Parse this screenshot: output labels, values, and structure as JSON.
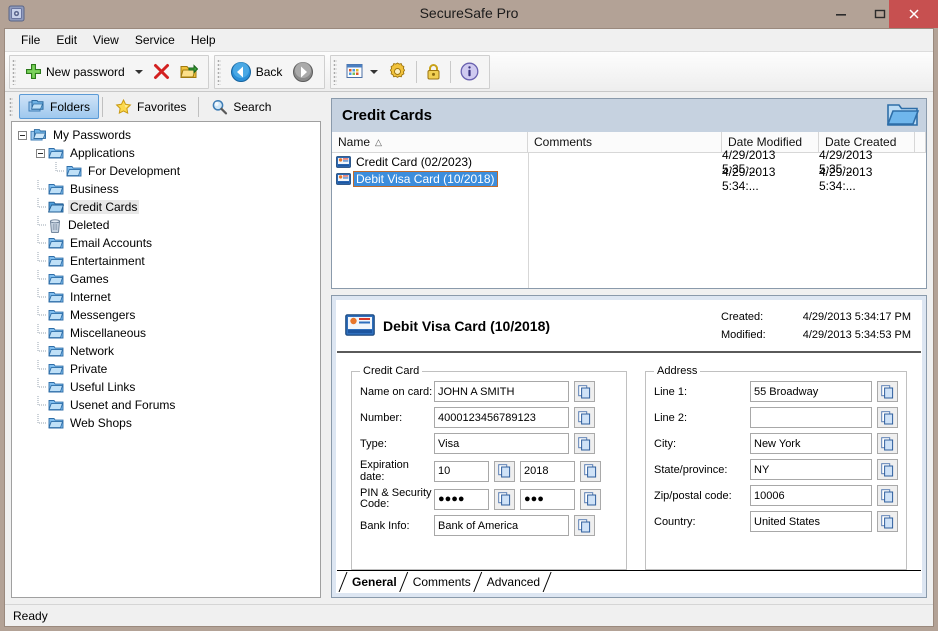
{
  "window": {
    "title": "SecureSafe Pro",
    "app_icon": "safe-icon",
    "minimize_label": "–",
    "maximize_label": "▭",
    "close_label": "✕",
    "titlebar_color": "#b3a296",
    "close_button_color": "#c75050"
  },
  "menubar": {
    "items": [
      {
        "label": "File"
      },
      {
        "label": "Edit"
      },
      {
        "label": "View"
      },
      {
        "label": "Service"
      },
      {
        "label": "Help"
      }
    ]
  },
  "toolbar": {
    "new_password_label": "New password",
    "back_label": "Back",
    "buttons": [
      {
        "name": "new-password",
        "label": "New password",
        "icon": "green-plus-icon"
      },
      {
        "name": "delete",
        "label": "",
        "icon": "red-x-icon"
      },
      {
        "name": "export",
        "label": "",
        "icon": "folder-export-icon"
      },
      {
        "name": "back",
        "label": "Back",
        "icon": "back-arrow-icon"
      },
      {
        "name": "forward",
        "label": "",
        "icon": "forward-arrow-icon"
      },
      {
        "name": "view-mode",
        "label": "",
        "icon": "window-list-icon"
      },
      {
        "name": "options",
        "label": "",
        "icon": "gear-icon"
      },
      {
        "name": "lock",
        "label": "",
        "icon": "padlock-icon"
      },
      {
        "name": "about",
        "label": "",
        "icon": "info-icon"
      }
    ]
  },
  "left_pane": {
    "tabs": [
      {
        "label": "Folders",
        "icon": "folders-icon",
        "active": true
      },
      {
        "label": "Favorites",
        "icon": "star-icon",
        "active": false
      },
      {
        "label": "Search",
        "icon": "magnifier-icon",
        "active": false
      }
    ],
    "tree": [
      {
        "label": "My Passwords",
        "depth": 0,
        "icon": "passwords-root-icon",
        "expander": "minus",
        "selected": false
      },
      {
        "label": "Applications",
        "depth": 1,
        "icon": "folder-icon",
        "expander": "minus",
        "selected": false
      },
      {
        "label": "For Development",
        "depth": 2,
        "icon": "folder-icon",
        "expander": "none",
        "selected": false
      },
      {
        "label": "Business",
        "depth": 1,
        "icon": "folder-icon",
        "expander": "none",
        "selected": false
      },
      {
        "label": "Credit Cards",
        "depth": 1,
        "icon": "folder-open-icon",
        "expander": "none",
        "selected": true
      },
      {
        "label": "Deleted",
        "depth": 1,
        "icon": "trash-icon",
        "expander": "none",
        "selected": false
      },
      {
        "label": "Email Accounts",
        "depth": 1,
        "icon": "folder-icon",
        "expander": "none",
        "selected": false
      },
      {
        "label": "Entertainment",
        "depth": 1,
        "icon": "folder-icon",
        "expander": "none",
        "selected": false
      },
      {
        "label": "Games",
        "depth": 1,
        "icon": "folder-icon",
        "expander": "none",
        "selected": false
      },
      {
        "label": "Internet",
        "depth": 1,
        "icon": "folder-icon",
        "expander": "none",
        "selected": false
      },
      {
        "label": "Messengers",
        "depth": 1,
        "icon": "folder-icon",
        "expander": "none",
        "selected": false
      },
      {
        "label": "Miscellaneous",
        "depth": 1,
        "icon": "folder-icon",
        "expander": "none",
        "selected": false
      },
      {
        "label": "Network",
        "depth": 1,
        "icon": "folder-icon",
        "expander": "none",
        "selected": false
      },
      {
        "label": "Private",
        "depth": 1,
        "icon": "folder-icon",
        "expander": "none",
        "selected": false
      },
      {
        "label": "Useful Links",
        "depth": 1,
        "icon": "folder-icon",
        "expander": "none",
        "selected": false
      },
      {
        "label": "Usenet and Forums",
        "depth": 1,
        "icon": "folder-icon",
        "expander": "none",
        "selected": false
      },
      {
        "label": "Web Shops",
        "depth": 1,
        "icon": "folder-icon",
        "expander": "none",
        "selected": false
      }
    ]
  },
  "list_panel": {
    "title": "Credit Cards",
    "header_icon": "open-folder-icon",
    "columns": [
      {
        "label": "Name",
        "sort": "△"
      },
      {
        "label": "Comments",
        "sort": ""
      },
      {
        "label": "Date Modified",
        "sort": ""
      },
      {
        "label": "Date Created",
        "sort": ""
      }
    ],
    "rows": [
      {
        "name": "Credit Card (02/2023)",
        "comments": "",
        "date_modified": "4/29/2013 5:35:...",
        "date_created": "4/29/2013 5:35:...",
        "icon": "credit-card-icon",
        "selected": false
      },
      {
        "name": "Debit Visa Card (10/2018)",
        "comments": "",
        "date_modified": "4/29/2013 5:34:...",
        "date_created": "4/29/2013 5:34:...",
        "icon": "credit-card-icon",
        "selected": true
      }
    ]
  },
  "detail": {
    "title": "Debit Visa Card (10/2018)",
    "icon": "credit-card-icon",
    "created_label": "Created:",
    "created_value": "4/29/2013 5:34:17 PM",
    "modified_label": "Modified:",
    "modified_value": "4/29/2013 5:34:53 PM",
    "credit_card_group": {
      "legend": "Credit Card",
      "fields": {
        "name_on_card_label": "Name on card:",
        "name_on_card_value": "JOHN A SMITH",
        "number_label": "Number:",
        "number_value": "4000123456789123",
        "type_label": "Type:",
        "type_value": "Visa",
        "expiration_label": "Expiration date:",
        "expiration_month": "10",
        "expiration_year": "2018",
        "pin_label": "PIN & Security Code:",
        "pin_value": "●●●●",
        "security_code_value": "●●●",
        "bank_info_label": "Bank Info:",
        "bank_info_value": "Bank of America"
      }
    },
    "address_group": {
      "legend": "Address",
      "fields": {
        "line1_label": "Line 1:",
        "line1_value": "55 Broadway",
        "line2_label": "Line 2:",
        "line2_value": "",
        "city_label": "City:",
        "city_value": "New York",
        "state_label": "State/province:",
        "state_value": "NY",
        "zip_label": "Zip/postal code:",
        "zip_value": "10006",
        "country_label": "Country:",
        "country_value": "United States"
      }
    },
    "tabs": [
      {
        "label": "General",
        "active": true
      },
      {
        "label": "Comments",
        "active": false
      },
      {
        "label": "Advanced",
        "active": false
      }
    ]
  },
  "statusbar": {
    "text": "Ready"
  }
}
